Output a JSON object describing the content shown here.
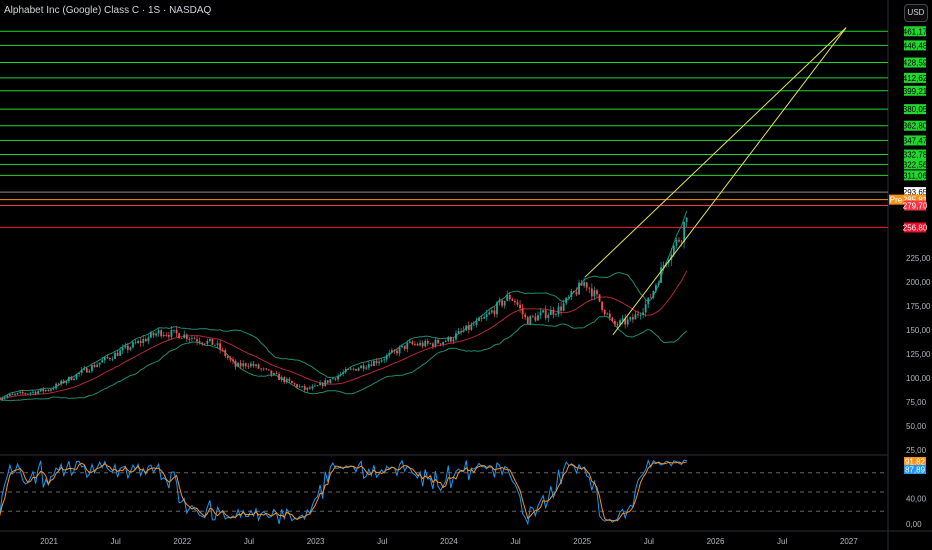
{
  "header": {
    "title": "Alphabet Inc (Google) Class C · 1S · NASDAQ",
    "currency_button": "USD"
  },
  "chart_data": {
    "type": "candlestick",
    "title": "Alphabet Inc (Google) Class C · 1S · NASDAQ",
    "interval": "1W",
    "x_ticks": [
      "2021",
      "Jul",
      "2022",
      "Jul",
      "2023",
      "Jul",
      "2024",
      "Jul",
      "2025",
      "Jul",
      "2026",
      "Jul",
      "2027"
    ],
    "y_ticks": [
      "25,00",
      "50,00",
      "75,00",
      "100,00",
      "125,00",
      "150,00",
      "175,00",
      "200,00",
      "225,00"
    ],
    "ylim": [
      25,
      470
    ],
    "price_anchors": {
      "t": [
        2020.63,
        2021.0,
        2021.5,
        2021.83,
        2022.0,
        2022.25,
        2022.4,
        2022.5,
        2022.73,
        2022.92,
        2023.0,
        2023.2,
        2023.5,
        2023.7,
        2023.85,
        2024.0,
        2024.25,
        2024.45,
        2024.5,
        2024.58,
        2024.83,
        2025.02,
        2025.13,
        2025.23,
        2025.37,
        2025.5,
        2025.63,
        2025.75,
        2025.8
      ],
      "close": [
        80,
        88,
        125,
        148,
        145,
        135,
        112,
        115,
        100,
        88,
        90,
        105,
        120,
        135,
        135,
        140,
        160,
        185,
        180,
        160,
        172,
        200,
        180,
        155,
        160,
        180,
        225,
        250,
        285
      ]
    },
    "indicators": [
      "Bollinger Bands (20)",
      "SMA 20",
      "Stochastic RSI"
    ],
    "horizontal_levels": [
      {
        "label": "461,17",
        "color": "#22d62f"
      },
      {
        "label": "446,48",
        "color": "#22d62f"
      },
      {
        "label": "428,59",
        "color": "#22d62f"
      },
      {
        "label": "412,62",
        "color": "#22d62f"
      },
      {
        "label": "399,21",
        "color": "#22d62f"
      },
      {
        "label": "380,05",
        "color": "#22d62f"
      },
      {
        "label": "362,80",
        "color": "#22d62f"
      },
      {
        "label": "347,47",
        "color": "#22d62f"
      },
      {
        "label": "332,78",
        "color": "#22d62f"
      },
      {
        "label": "322,56",
        "color": "#22d62f"
      },
      {
        "label": "311,06",
        "color": "#22d62f"
      },
      {
        "label": "293,65",
        "color": "#ffffff"
      },
      {
        "label": "285,81",
        "color": "#f7931a",
        "prefix": "Pre"
      },
      {
        "label": "279,70",
        "color": "#f23645"
      },
      {
        "label": "256,80",
        "color": "#e8102a"
      }
    ],
    "trendlines": [
      {
        "from": [
          2025.02,
          205
        ],
        "to": [
          2026.98,
          465
        ]
      },
      {
        "from": [
          2025.23,
          145
        ],
        "to": [
          2026.98,
          465
        ]
      }
    ],
    "oscillator": {
      "ticks": [
        "40,00",
        "0,00"
      ],
      "levels": [
        80,
        50,
        20
      ],
      "k_label": "91,82",
      "d_label": "87,89",
      "k_color": "#f7931a",
      "d_color": "#2196f3"
    }
  }
}
